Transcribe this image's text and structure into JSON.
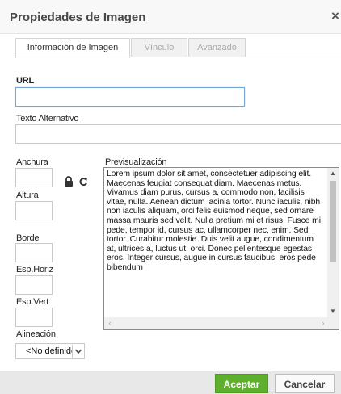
{
  "dialog": {
    "title": "Propiedades de Imagen",
    "close_glyph": "×"
  },
  "tabs": [
    {
      "label": "Información de Imagen",
      "active": true
    },
    {
      "label": "Vínculo",
      "active": false
    },
    {
      "label": "Avanzado",
      "active": false
    }
  ],
  "fields": {
    "url_label": "URL",
    "url_value": "",
    "alt_label": "Texto Alternativo",
    "alt_value": "",
    "width_label": "Anchura",
    "height_label": "Altura",
    "border_label": "Borde",
    "hspace_label": "Esp.Horiz",
    "vspace_label": "Esp.Vert",
    "align_label": "Alineación",
    "align_value": "<No definido>"
  },
  "icons": {
    "lock": "lock-icon",
    "reset": "refresh-icon"
  },
  "preview": {
    "label": "Previsualización",
    "text": "Lorem ipsum dolor sit amet, consectetuer adipiscing elit. Maecenas feugiat consequat diam. Maecenas metus. Vivamus diam purus, cursus a, commodo non, facilisis vitae, nulla. Aenean dictum lacinia tortor. Nunc iaculis, nibh non iaculis aliquam, orci felis euismod neque, sed ornare massa mauris sed velit. Nulla pretium mi et risus. Fusce mi pede, tempor id, cursus ac, ullamcorper nec, enim. Sed tortor. Curabitur molestie. Duis velit augue, condimentum at, ultrices a, luctus ut, orci. Donec pellentesque egestas eros. Integer cursus, augue in cursus faucibus, eros pede bibendum"
  },
  "buttons": {
    "ok": "Aceptar",
    "cancel": "Cancelar"
  },
  "colors": {
    "accent": "#5faf2f",
    "focus_border": "#7aa6d6"
  }
}
